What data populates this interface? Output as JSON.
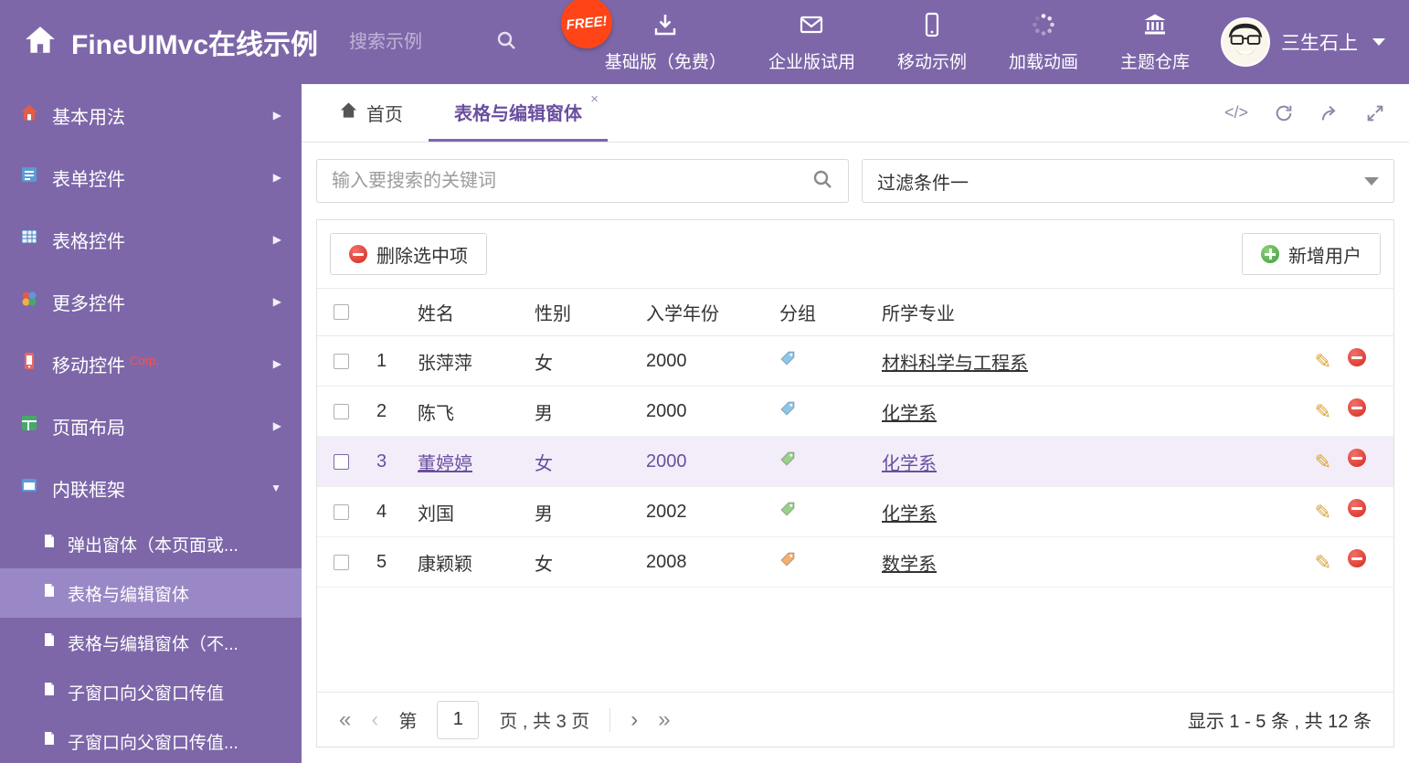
{
  "glyphs": {
    "close": "×",
    "chevron_right": "▶",
    "chevron_down": "▼",
    "code": "</>",
    "pencil": "✎",
    "first": "«",
    "prev": "‹",
    "next": "›",
    "last": "»"
  },
  "colors": {
    "accent": "#7d67a9",
    "tag_blue": "#8ec6ea",
    "tag_green": "#9ad089",
    "tag_orange": "#f4ae72"
  },
  "header": {
    "title": "FineUIMvc在线示例",
    "search_placeholder": "搜索示例",
    "free_badge": "FREE!",
    "nav": [
      {
        "label": "基础版（免费）"
      },
      {
        "label": "企业版试用"
      },
      {
        "label": "移动示例"
      },
      {
        "label": "加载动画"
      },
      {
        "label": "主题仓库"
      }
    ],
    "user_name": "三生石上"
  },
  "sidebar": {
    "items": [
      {
        "label": "基本用法"
      },
      {
        "label": "表单控件"
      },
      {
        "label": "表格控件"
      },
      {
        "label": "更多控件"
      },
      {
        "label": "移动控件",
        "badge": "Corp."
      },
      {
        "label": "页面布局"
      },
      {
        "label": "内联框架"
      }
    ],
    "subitems": [
      {
        "label": "弹出窗体（本页面或..."
      },
      {
        "label": "表格与编辑窗体"
      },
      {
        "label": "表格与编辑窗体（不..."
      },
      {
        "label": "子窗口向父窗口传值"
      },
      {
        "label": "子窗口向父窗口传值..."
      }
    ]
  },
  "tabs": [
    {
      "label": "首页"
    },
    {
      "label": "表格与编辑窗体"
    }
  ],
  "filter": {
    "search_placeholder": "输入要搜索的关键词",
    "dropdown_value": "过滤条件一"
  },
  "toolbar": {
    "delete_label": "删除选中项",
    "add_label": "新增用户"
  },
  "table": {
    "headers": {
      "name": "姓名",
      "gender": "性别",
      "year": "入学年份",
      "group": "分组",
      "major": "所学专业"
    },
    "rows": [
      {
        "num": "1",
        "name": "张萍萍",
        "gender": "女",
        "year": "2000",
        "tag": "blue",
        "major": "材料科学与工程系",
        "selected": false
      },
      {
        "num": "2",
        "name": "陈飞",
        "gender": "男",
        "year": "2000",
        "tag": "blue",
        "major": "化学系",
        "selected": false
      },
      {
        "num": "3",
        "name": "董婷婷",
        "gender": "女",
        "year": "2000",
        "tag": "green",
        "major": "化学系",
        "selected": true
      },
      {
        "num": "4",
        "name": "刘国",
        "gender": "男",
        "year": "2002",
        "tag": "green",
        "major": "化学系",
        "selected": false
      },
      {
        "num": "5",
        "name": "康颖颖",
        "gender": "女",
        "year": "2008",
        "tag": "orange",
        "major": "数学系",
        "selected": false
      }
    ]
  },
  "pagination": {
    "prefix": "第",
    "current_page": "1",
    "suffix": "页 , 共 3 页",
    "summary": "显示 1 - 5 条 , 共 12 条"
  }
}
